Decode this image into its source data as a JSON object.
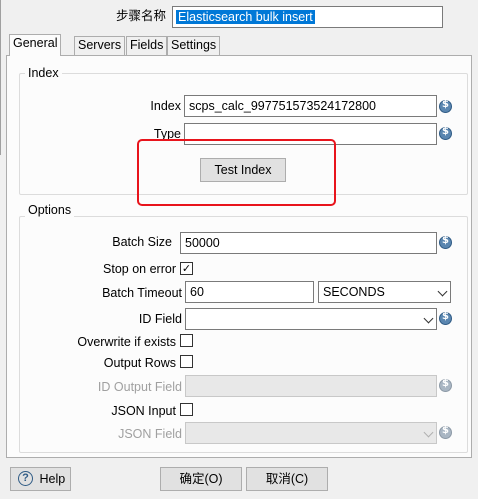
{
  "step": {
    "name_label": "步骤名称",
    "name_value": "Elasticsearch bulk insert"
  },
  "tabs": [
    "General",
    "Servers",
    "Fields",
    "Settings"
  ],
  "index_group": {
    "title": "Index",
    "index_label": "Index",
    "index_value": "scps_calc_997751573524172800",
    "type_label": "Type",
    "type_value": "",
    "test_button": "Test Index"
  },
  "options_group": {
    "title": "Options",
    "batch_size_label": "Batch Size",
    "batch_size_value": "50000",
    "stop_on_error_label": "Stop on error",
    "stop_on_error_checked": true,
    "batch_timeout_label": "Batch Timeout",
    "batch_timeout_value": "60",
    "batch_timeout_unit": "SECONDS",
    "id_field_label": "ID Field",
    "id_field_value": "",
    "overwrite_label": "Overwrite if exists",
    "overwrite_checked": false,
    "output_rows_label": "Output Rows",
    "output_rows_checked": false,
    "id_output_field_label": "ID Output Field",
    "json_input_label": "JSON Input",
    "json_input_checked": false,
    "json_field_label": "JSON Field"
  },
  "footer": {
    "help_label": "Help",
    "ok_label": "确定(O)",
    "cancel_label": "取消(C)"
  },
  "colors": {
    "highlight_box": "#e8141c",
    "selection": "#0078d7"
  },
  "icons": [
    "variable-icon",
    "checkmark-icon",
    "help-icon",
    "chevron-down-icon"
  ]
}
